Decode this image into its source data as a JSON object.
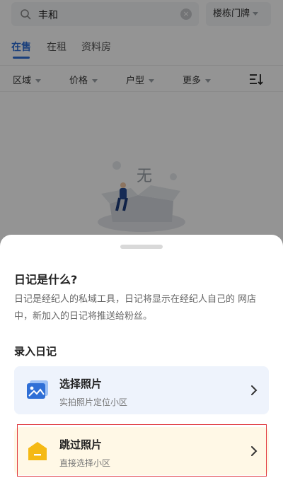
{
  "search": {
    "query": "丰和",
    "building_button": "楼栋门牌"
  },
  "tabs": [
    {
      "label": "在售",
      "active": true
    },
    {
      "label": "在租",
      "active": false
    },
    {
      "label": "资料房",
      "active": false
    }
  ],
  "filters": [
    "区域",
    "价格",
    "户型",
    "更多"
  ],
  "empty_state": {
    "illustration_char": "无"
  },
  "sheet": {
    "title": "日记是什么?",
    "description": "日记是经纪人的私域工具，日记将显示在经纪人自己的 网店中，新加入的日记将推送给粉丝。",
    "section_title": "录入日记",
    "options": [
      {
        "title": "选择照片",
        "subtitle": "实拍照片定位小区",
        "icon": "image-icon"
      },
      {
        "title": "跳过照片",
        "subtitle": "直接选择小区",
        "icon": "house-icon"
      }
    ]
  },
  "colors": {
    "accent": "#2f6fd6",
    "photo_bg": "#eef3fc",
    "skip_bg": "#fff8e6",
    "house_icon": "#f5b914",
    "highlight": "#e0343a"
  }
}
